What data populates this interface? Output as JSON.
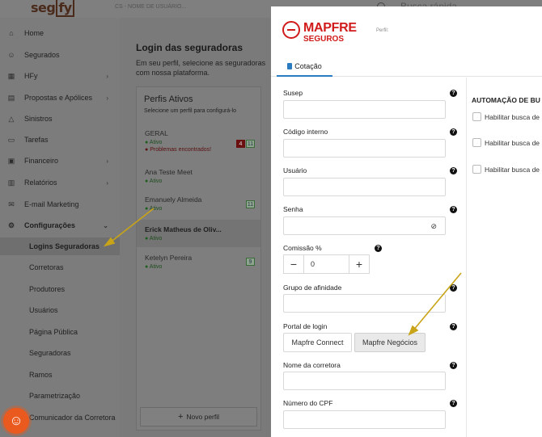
{
  "topbar": {
    "logo_a": "seg",
    "logo_b": "fy",
    "user": "CS - NOME DE USUÁRIO...",
    "search_placeholder": "Busca rápida"
  },
  "sidebar": {
    "items": [
      {
        "label": "Home",
        "icon": "home-icon"
      },
      {
        "label": "Segurados",
        "icon": "users-icon"
      },
      {
        "label": "HFy",
        "icon": "calculator-icon"
      },
      {
        "label": "Propostas e Apólices",
        "icon": "document-icon"
      },
      {
        "label": "Sinistros",
        "icon": "warning-icon"
      },
      {
        "label": "Tarefas",
        "icon": "car-icon"
      },
      {
        "label": "Financeiro",
        "icon": "money-icon"
      },
      {
        "label": "Relatórios",
        "icon": "chart-icon"
      },
      {
        "label": "E-mail Marketing",
        "icon": "mail-icon"
      },
      {
        "label": "Configurações",
        "icon": "gear-icon"
      }
    ],
    "sub_items": [
      "Logins Seguradoras",
      "Corretoras",
      "Produtores",
      "Usuários",
      "Página Pública",
      "Seguradoras",
      "Ramos",
      "Parametrização",
      "Comunicador da Corretora"
    ]
  },
  "content": {
    "title": "Login das seguradoras",
    "desc": "Em seu perfil, selecione as seguradoras com nossa plataforma.",
    "profiles_title": "Perfis Ativos",
    "profiles_sub": "Selecione um perfil para configurá-lo",
    "profiles": [
      {
        "name": "GERAL",
        "status": "Ativo",
        "problem": "Problemas encontrados!",
        "badge_red": "4",
        "badge": "11"
      },
      {
        "name": "Ana Teste Meet",
        "status": "Ativo"
      },
      {
        "name": "Emanuely Almeida",
        "status": "Ativo",
        "badge": "11"
      },
      {
        "name": "Erick Matheus de Oliv...",
        "status": "Ativo"
      },
      {
        "name": "Ketelyn Pereira",
        "status": "Ativo",
        "badge": "9"
      }
    ],
    "new_profile": "Novo perfil"
  },
  "modal": {
    "brand": "MAPFRE",
    "brand_sub": "SEGUROS",
    "perfil_label": "Perfil:",
    "tab_label": "Cotação",
    "fields": {
      "susep": "Susep",
      "codigo": "Código interno",
      "usuario": "Usuário",
      "senha": "Senha",
      "comissao": "Comissão %",
      "comissao_value": "0",
      "grupo": "Grupo de afinidade",
      "portal": "Portal de login",
      "portal_opt1": "Mapfre Connect",
      "portal_opt2": "Mapfre Negócios",
      "nome_corretora": "Nome da corretora",
      "cpf": "Número do CPF"
    },
    "automation_title": "AUTOMAÇÃO DE BU",
    "checks": [
      "Habilitar busca de",
      "Habilitar busca de",
      "Habilitar busca de"
    ]
  }
}
